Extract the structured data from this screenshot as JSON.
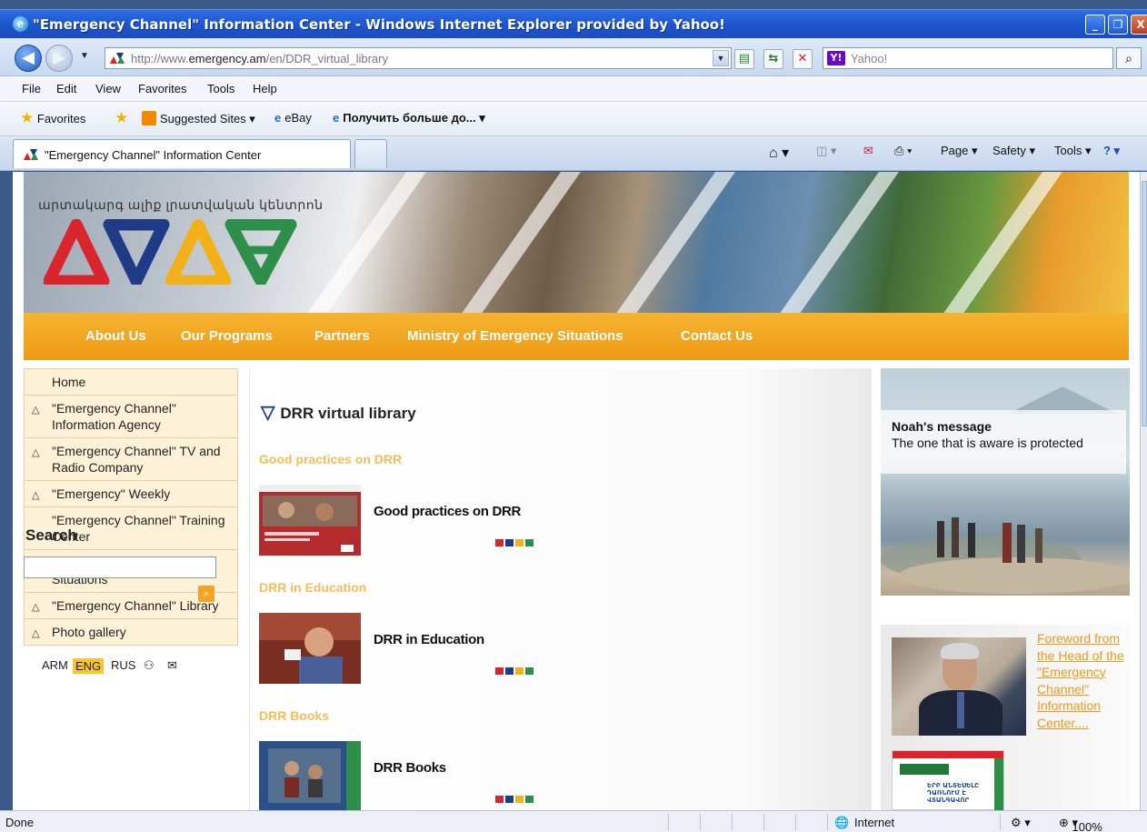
{
  "window": {
    "title": "\"Emergency Channel\" Information Center - Windows Internet Explorer provided by Yahoo!",
    "min_glyph": "_",
    "restore_glyph": "❐",
    "close_glyph": "X"
  },
  "address": {
    "url_prefix": "http://www.",
    "url_domain": "emergency.am",
    "url_path": "/en/DDR_virtual_library",
    "search_placeholder": "Yahoo!",
    "search_brand": "Y!"
  },
  "menu": [
    "File",
    "Edit",
    "View",
    "Favorites",
    "Tools",
    "Help"
  ],
  "favorites_bar": {
    "favorites": "Favorites",
    "suggested": "Suggested Sites ▾",
    "ebay": "eBay",
    "russian": "Получить больше до... ▾"
  },
  "tab": {
    "label": "\"Emergency Channel\" Information Center"
  },
  "command_bar": {
    "page": "Page ▾",
    "safety": "Safety ▾",
    "tools": "Tools ▾"
  },
  "site": {
    "armenian_title": "արտակարգ ալիք լրատվական կենտրոն",
    "nav": [
      "About Us",
      "Our Programs",
      "Partners",
      "Ministry of Emergency Situations",
      "Contact Us"
    ],
    "left_nav": [
      {
        "label": "Home",
        "arrow": false
      },
      {
        "label": "\"Emergency Channel\" Information Agency",
        "arrow": true
      },
      {
        "label": "\"Emergency Channel\" TV and Radio Company",
        "arrow": true
      },
      {
        "label": "\"Emergency\" Weekly",
        "arrow": true
      },
      {
        "label": "\"Emergency Channel\" Training Center",
        "arrow": false
      },
      {
        "label": "Encyclopedia of Emergency Situations",
        "arrow": true
      },
      {
        "label": "\"Emergency Channel\" Library",
        "arrow": true
      },
      {
        "label": "Photo gallery",
        "arrow": true
      }
    ],
    "languages": {
      "arm": "ARM",
      "eng": "ENG",
      "rus": "RUS"
    },
    "search_title": "Search",
    "page_title": "DRR virtual library",
    "sections": [
      {
        "heading": "Good practices on DRR",
        "item": "Good practices on DRR"
      },
      {
        "heading": "DRR in Education",
        "item": "DRR in Education"
      },
      {
        "heading": "DRR Books",
        "item": "DRR Books"
      }
    ],
    "noah": {
      "title": "Noah's message",
      "subtitle": "The one that is aware is protected"
    },
    "foreword_link": "Foreword from the Head of the \"Emergency Channel\" Information Center....",
    "book_cover_text": "ԵՐԲ ԱՆՏԵՍԵԼԸ ԴԱՌՆՈՒՄ Է ՎՏԱՆԳԱՎՈՐ"
  },
  "status": {
    "left": "Done",
    "zone": "Internet",
    "zoom": "100%"
  },
  "colors": {
    "accent_orange": "#ee9a14",
    "logo_red": "#d8262c",
    "logo_blue": "#1f3b86",
    "logo_yellow": "#f2b11a",
    "logo_green": "#2e8f4a"
  }
}
